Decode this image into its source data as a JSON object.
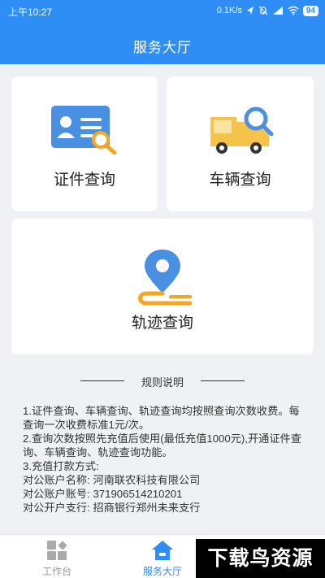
{
  "status_bar": {
    "time": "上午10:27",
    "network_speed": "0.1K/s",
    "battery": "94"
  },
  "header": {
    "title": "服务大厅"
  },
  "cards": {
    "certificate": {
      "label": "证件查询",
      "icon": "id-card-search-icon"
    },
    "vehicle": {
      "label": "车辆查询",
      "icon": "truck-search-icon"
    },
    "track": {
      "label": "轨迹查询",
      "icon": "location-track-icon"
    }
  },
  "rules": {
    "title": "规则说明",
    "lines": [
      "1.证件查询、车辆查询、轨迹查询均按照查询次数收费。每查询一次收费标准1元/次。",
      "2.查询次数按照先充值后使用(最低充值1000元),开通证件查询、车辆查询、轨迹查询功能。",
      "3.充值打款方式:",
      "对公账户名称: 河南联农科技有限公司",
      "对公账户账号: 371906514210201",
      "对公开户支行: 招商银行郑州未来支行"
    ]
  },
  "bottom_nav": {
    "workbench": "工作台",
    "service_hall": "服务大厅"
  },
  "watermark": "下载鸟资源",
  "colors": {
    "primary": "#2f8ef5",
    "icon_blue": "#4a90e2",
    "icon_orange": "#f5a623"
  }
}
